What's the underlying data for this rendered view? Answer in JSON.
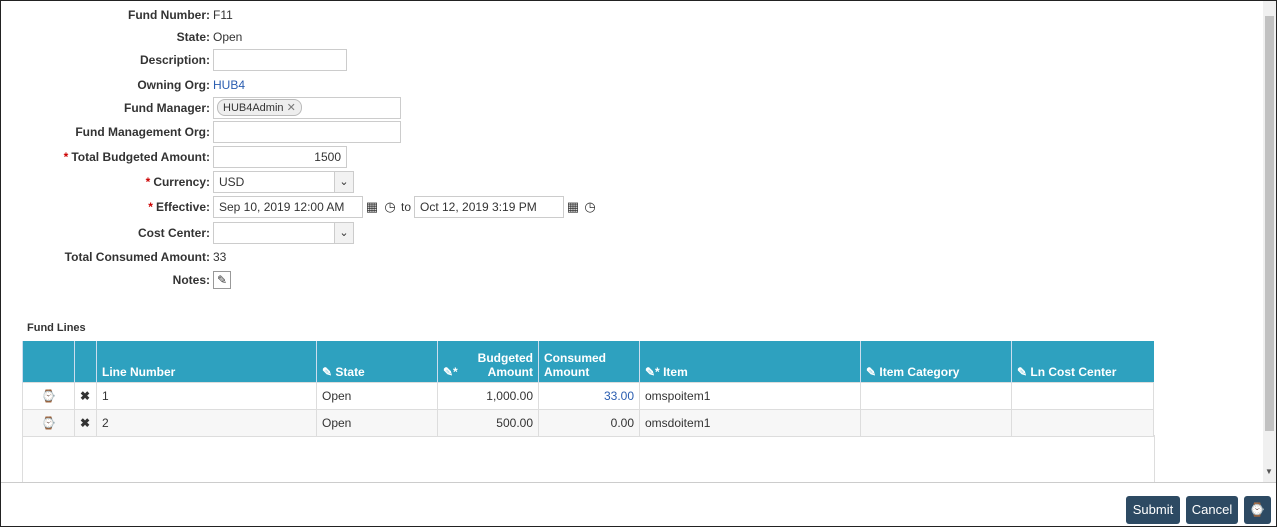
{
  "form": {
    "fund_number": {
      "label": "Fund Number:",
      "value": "F11"
    },
    "state": {
      "label": "State:",
      "value": "Open"
    },
    "description": {
      "label": "Description:",
      "value": ""
    },
    "owning_org": {
      "label": "Owning Org:",
      "value": "HUB4"
    },
    "fund_manager": {
      "label": "Fund Manager:",
      "chip": "HUB4Admin"
    },
    "fund_management_org": {
      "label": "Fund Management Org:",
      "value": ""
    },
    "total_budgeted": {
      "label": "Total Budgeted Amount:",
      "value": "1500"
    },
    "currency": {
      "label": "Currency:",
      "value": "USD"
    },
    "effective": {
      "label": "Effective:",
      "from": "Sep 10, 2019 12:00 AM",
      "to_label": "to",
      "to": "Oct 12, 2019 3:19 PM"
    },
    "cost_center": {
      "label": "Cost Center:",
      "value": ""
    },
    "total_consumed": {
      "label": "Total Consumed Amount:",
      "value": "33"
    },
    "notes": {
      "label": "Notes:"
    },
    "required_mark": "*"
  },
  "fund_lines": {
    "title": "Fund Lines",
    "headers": [
      "",
      "",
      "Line Number",
      "State",
      "Budgeted Amount",
      "Consumed Amount",
      "Item",
      "Item Category",
      "Ln Cost Center"
    ],
    "rows": [
      {
        "line": "1",
        "state": "Open",
        "budgeted": "1,000.00",
        "consumed": "33.00",
        "item": "omspoitem1",
        "category": "",
        "cost_center": ""
      },
      {
        "line": "2",
        "state": "Open",
        "budgeted": "500.00",
        "consumed": "0.00",
        "item": "omsdoitem1",
        "category": "",
        "cost_center": ""
      }
    ]
  },
  "footer": {
    "submit": "Submit",
    "cancel": "Cancel"
  }
}
